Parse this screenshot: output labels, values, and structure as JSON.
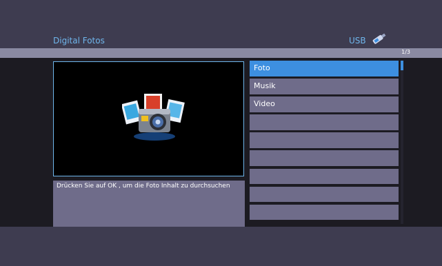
{
  "header": {
    "title": "Digital Fotos",
    "source_label": "USB",
    "source_icon": "usb-stick-icon",
    "page_counter": "1/3"
  },
  "preview": {
    "icon": "photo-camera-icon"
  },
  "hint": {
    "text": "Drücken Sie auf OK , um die Foto Inhalt zu durchsuchen"
  },
  "menu": {
    "items": [
      {
        "label": "Foto",
        "selected": true
      },
      {
        "label": "Musik",
        "selected": false
      },
      {
        "label": "Video",
        "selected": false
      },
      {
        "label": "",
        "selected": false
      },
      {
        "label": "",
        "selected": false
      },
      {
        "label": "",
        "selected": false
      },
      {
        "label": "",
        "selected": false
      },
      {
        "label": "",
        "selected": false
      },
      {
        "label": "",
        "selected": false
      }
    ]
  },
  "colors": {
    "accent": "#3d8fe0",
    "title_text": "#6fb6ec",
    "panel": "#6f6c8a",
    "background": "#3c3a4d"
  }
}
